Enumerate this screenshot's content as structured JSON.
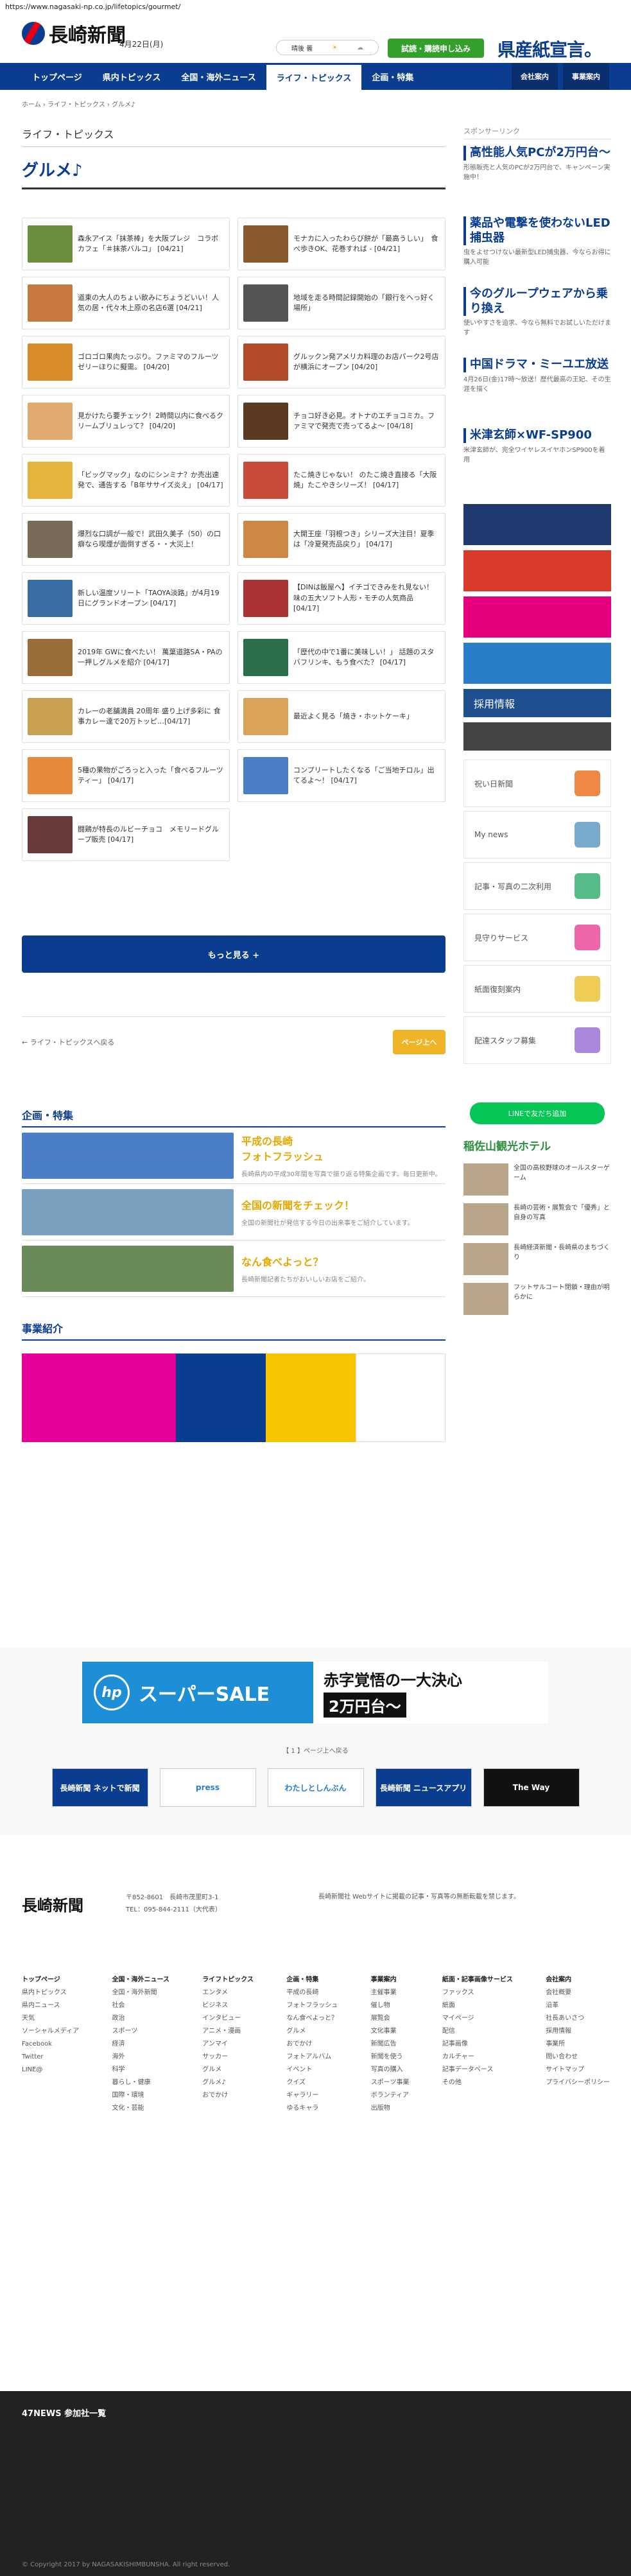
{
  "url": "https://www.nagasaki-np.co.jp/lifetopics/gourmet/",
  "header": {
    "logo": "長崎新聞",
    "date": "4月22日(月)",
    "weather": "晴後 曇",
    "trial": "試読・購読申し込み",
    "brand": "県産紙宣言。"
  },
  "nav": {
    "items": [
      "トップページ",
      "県内トピックス",
      "全国・海外ニュース",
      "ライフ・トピックス",
      "企画・特集"
    ],
    "right": [
      "会社案内",
      "事業案内"
    ]
  },
  "breadcrumb": "ホーム › ライフ・トピックス › グルメ♪",
  "section": "ライフ・トピックス",
  "category": "グルメ♪",
  "articles": [
    {
      "t": "森永アイス「抹茶棒」を大阪プレジ　コラボカフェ「＃抹茶バルコ」 [04/21]",
      "c": "#6b8e3c"
    },
    {
      "t": "モナカに入ったわらび餅が「最高うしい」　食べ歩きOK、花巻すれば - [04/21]",
      "c": "#8a5a2e"
    },
    {
      "t": "道東の大人のちょい飲みにちょうどいい！人気の居・代々木上原の名店6選 [04/21]",
      "c": "#c7783c"
    },
    {
      "t": "地域を走る時間記録開始の「銀行をへっ好く場所」",
      "c": "#555"
    },
    {
      "t": "ゴロゴロ果肉たっぷり。ファミマのフルーツゼリーほりに擬需。 [04/20]",
      "c": "#d98b2a"
    },
    {
      "t": "グルックン発アメリカ料理のお店パーク2号店が横浜にオープン [04/20]",
      "c": "#b34a2a"
    },
    {
      "t": "見かけたら要チェック！2時間以内に食べるクリームブリュレって？ [04/20]",
      "c": "#e0a96d"
    },
    {
      "t": "チョコ好き必見。オトナのエチョコミカ。ファミマで発売で売ってるよ～ [04/18]",
      "c": "#5c3a21"
    },
    {
      "t": "「ビッグマック」なのにシンミナ？か売出速発で、通告する「B年ササイズ炎え」 [04/17]",
      "c": "#e4b53a"
    },
    {
      "t": "たこ焼きじゃない！ のたこ焼き直接る「大阪焼」たこやきシリーズ！ [04/17]",
      "c": "#c94b3a"
    },
    {
      "t": "爆烈な口調が一般で！武田久美子（50）の口癖なら喫煙が面倒すぎる・・大災上！",
      "c": "#7a6a5a"
    },
    {
      "t": "大開王座「羽根つき」シリーズ大注目！夏季は「冷夏発売品戻り」 [04/17]",
      "c": "#c84"
    },
    {
      "t": "新しい温度ソリート「TAOYA淡路」が4月19日にグランドオープン [04/17]",
      "c": "#3a6ea5"
    },
    {
      "t": "【DINは飯屋へ】イチゴできみをれ見ない！味の五大ソフト人形・モチの人気商品 [04/17]",
      "c": "#a33"
    },
    {
      "t": "2019年 GWに食べたい！ 萬葉道路SA・PAの一押しグルメを紹介 [04/17]",
      "c": "#9a6e3a"
    },
    {
      "t": "「歴代の中で1番に美味しい！」 話題のスタバフリンキ、もう食べた？ [04/17]",
      "c": "#2a6e4a"
    },
    {
      "t": "カレーの老舗満員 20周年 盛り上げ多彩に 食事カレー達で20万トッピ…[04/17]",
      "c": "#c8a050"
    },
    {
      "t": "最近よく見る「焼き・ホットケーキ」",
      "c": "#d9a45a"
    },
    {
      "t": "5種の果物がごろっと入った「食べるフルーツティー」 [04/17]",
      "c": "#e68a3a"
    },
    {
      "t": "コンプリートしたくなる「ご当地チロル」出てるよ～！ [04/17]",
      "c": "#4a7ec7"
    },
    {
      "t": "闘鶏が特長のルビーチョコ　メモリードグループ販売 [04/17]",
      "c": "#6a3a3a"
    }
  ],
  "more": "もっと見る +",
  "back": "← ライフ・トピックスへ戻る",
  "pagetop": "ページ上へ",
  "features_title": "企画・特集",
  "features": [
    {
      "t": "平成の長崎\nフォトフラッシュ",
      "d": "長崎県内の平成30年間を写真で振り返る特集企画です。毎日更新中。"
    },
    {
      "t": "全国の新聞をチェック！",
      "d": "全国の新聞社が発信する今日の出来事をご紹介しています。"
    },
    {
      "t": "なん食べよっと？",
      "d": "長崎新聞記者たちがおいしいお店をご紹介。"
    }
  ],
  "business_title": "事業紹介",
  "ad_text": "スーパーSALE",
  "ad_text2": "赤字覚悟の一大決心",
  "ad_price": "2万円台～",
  "pager": "【 1 】ページ上へ戻る",
  "network": [
    "長崎新聞 ネットで新聞",
    "press",
    "わたしとしんぶん",
    "長崎新聞 ニュースアプリ",
    "The Way"
  ],
  "footer": {
    "addr": "〒852-8601　長崎市茂里町3-1",
    "tel": "TEL：095-844-2111（大代表）",
    "note": "長崎新聞社 Webサイトに掲載の記事・写真等の無断転載を禁じます。",
    "cols": [
      {
        "h": "トップページ",
        "items": [
          "県内トピックス",
          "県内ニュース",
          "天気",
          "ソーシャルメディア",
          "Facebook",
          "Twitter",
          "LINE@"
        ]
      },
      {
        "h": "全国・海外ニュース",
        "items": [
          "全国・海外新聞",
          "社会",
          "政治",
          "スポーツ",
          "経済",
          "海外",
          "科学",
          "暮らし・健康",
          "国際・環境",
          "文化・芸能"
        ]
      },
      {
        "h": "ライフトピックス",
        "items": [
          "エンタメ",
          "ビジネス",
          "インタビュー",
          "アニメ・漫画",
          "アンマイ",
          "サッカー",
          "グルメ",
          "グルメ♪",
          "おでかけ"
        ]
      },
      {
        "h": "企画・特集",
        "items": [
          "平成の長崎",
          "フォトフラッシュ",
          "なん食べよっと？",
          "グルメ",
          "おでかけ",
          "フォトアルバム",
          "イベント",
          "クイズ",
          "ギャラリー",
          "ゆるキャラ"
        ]
      },
      {
        "h": "事業案内",
        "items": [
          "主催事業",
          "催し物",
          "展覧会",
          "文化事業",
          "新聞広告",
          "新聞を使う",
          "写真の購入",
          "スポーツ事業",
          "ボランティア",
          "出版物"
        ]
      },
      {
        "h": "紙面・記事画像サービス",
        "items": [
          "ファックス",
          "紙面",
          "マイページ",
          "配信",
          "記事画像",
          "カルチャー",
          "記事データベース",
          "その他"
        ]
      },
      {
        "h": "会社案内",
        "items": [
          "会社概要",
          "沿革",
          "社長あいさつ",
          "採用情報",
          "事業所",
          "問い合わせ",
          "サイトマップ",
          "プライバシーポリシー"
        ]
      }
    ],
    "net_title": "47NEWS 参加社一覧",
    "copyright": "© Copyright 2017 by NAGASAKISHIMBUNSHA. All right reserved."
  },
  "sidebar": {
    "sponsor": "スポンサーリンク",
    "ads": [
      {
        "h": "高性能人気PCが2万円台～",
        "d": "形態販売と人気のPCが2万円台で、キャンペーン実施中！"
      },
      {
        "h": "薬品や電撃を使わないLED捕虫器",
        "d": "虫をよせつけない最新型LED捕虫器、今ならお得に購入可能"
      },
      {
        "h": "今のグループウェアから乗り換え",
        "d": "使いやすさを追求、今なら無料でお試しいただけます"
      },
      {
        "h": "中国ドラマ・ミーユエ放送",
        "d": "4月26日(金)17時～放送！歴代最高の王妃、その生涯を描く"
      },
      {
        "h": "米津玄師×WF-SP900",
        "d": "米津玄師が、完全ワイヤレスイヤホンSP900を着用"
      }
    ],
    "links": [
      "祝い日新聞",
      "My news",
      "記事・写真の二次利用",
      "見守りサービス",
      "紙面復刻案内",
      "配達スタッフ募集"
    ],
    "recruit": "採用情報",
    "line": "LINEで友だち追加",
    "hotel": "稲佐山観光ホテル",
    "side_articles": [
      "全国の高校野球のオールスターゲーム",
      "長崎の芸術・展覧会で「優秀」と自身の写真",
      "長崎経済新聞・長崎県のまちづくり",
      "フットサルコート閉鎖・理由が明らかに"
    ]
  }
}
